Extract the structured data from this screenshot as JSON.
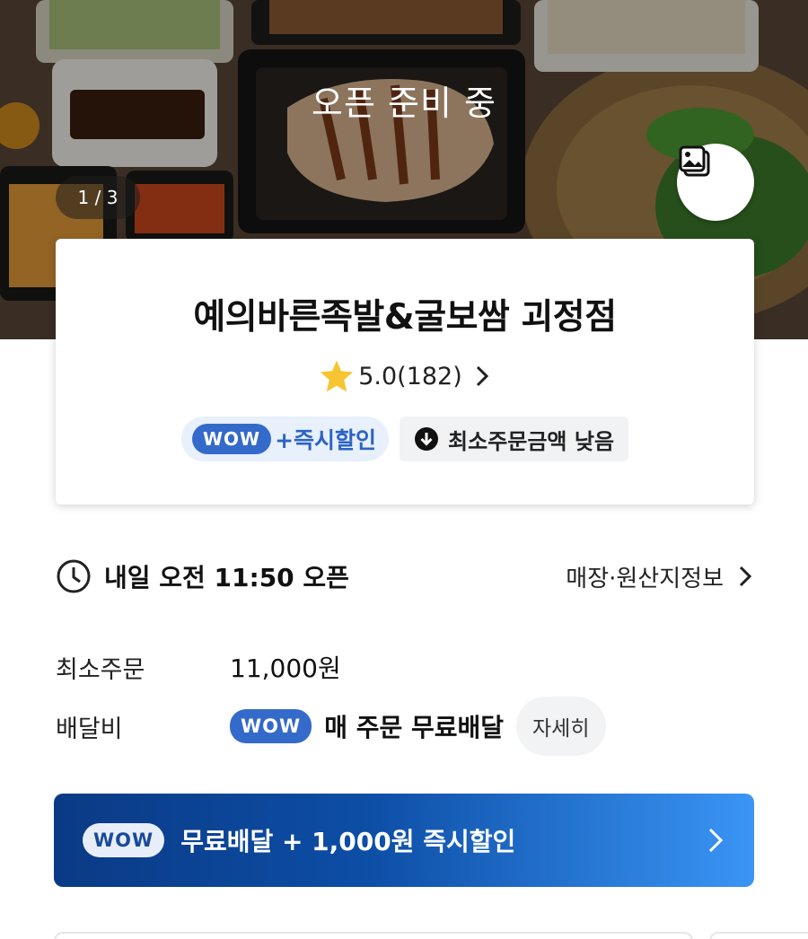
{
  "hero": {
    "status": "오픈 준비 중",
    "image_counter": "1 / 3",
    "gallery_icon": "image-gallery-icon"
  },
  "store": {
    "name": "예의바른족발&굴보쌈 괴정점",
    "rating": "5.0(182)",
    "rating_icon": "star-icon",
    "badges": {
      "wow_label": "WOW",
      "wow_discount": "+즉시할인",
      "min_order_badge": "최소주문금액 낮음",
      "min_order_icon": "arrow-down-circle-icon"
    }
  },
  "info": {
    "open_time": "내일 오전 11:50 오픈",
    "store_info_link": "매장·원산지정보",
    "min_order_label": "최소주문",
    "min_order_value": "11,000원",
    "delivery_fee_label": "배달비",
    "delivery_wow_label": "WOW",
    "delivery_fee_value": "매 주문 무료배달",
    "detail_button": "자세히"
  },
  "banner": {
    "wow_label": "WOW",
    "text": "무료배달 + 1,000원 즉시할인"
  },
  "colors": {
    "accent_blue": "#346aca",
    "banner_start": "#0a3a85",
    "banner_end": "#3a95f5",
    "star": "#f7c531"
  }
}
